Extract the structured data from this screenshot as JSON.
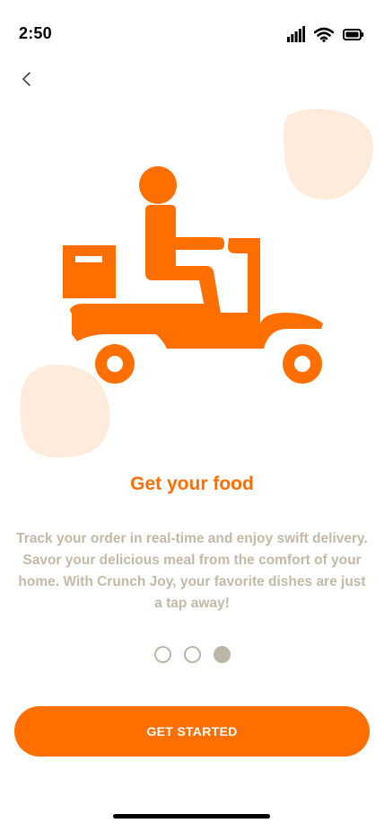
{
  "status_bar": {
    "time": "2:50",
    "icons": [
      "signal-icon",
      "wifi-icon",
      "battery-icon"
    ]
  },
  "navigation": {
    "back_icon": "chevron-left-icon"
  },
  "illustration": {
    "subject": "delivery-scooter-icon",
    "primary_color": "#FF6F00",
    "blob_color": "#FDEBDC"
  },
  "onboarding": {
    "title": "Get your food",
    "description": "Track your order in real-time and enjoy swift delivery. Savor your delicious meal from the comfort of your home. With Crunch Joy, your favorite dishes are just a tap away!",
    "pagination": {
      "total": 3,
      "active_index": 2
    }
  },
  "actions": {
    "get_started_label": "GET STARTED"
  },
  "colors": {
    "accent": "#FF6F00",
    "muted_text": "#C2B9A7",
    "dot": "#BDB5A6"
  }
}
